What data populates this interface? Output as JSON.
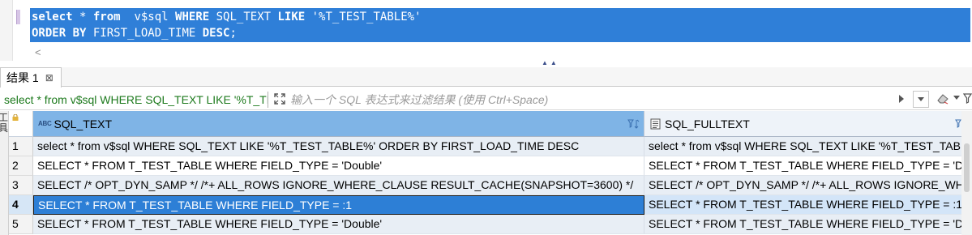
{
  "editor": {
    "line1": {
      "kw_select": "select",
      "star": " * ",
      "kw_from": "from",
      "table": "  v$sql ",
      "kw_where": "WHERE",
      "col": " SQL_TEXT ",
      "kw_like": "LIKE",
      "pattern": " '%T_TEST_TABLE%'"
    },
    "line2": {
      "kw_orderby": "ORDER BY",
      "rest": " FIRST_LOAD_TIME ",
      "kw_desc": "DESC",
      "semicolon": ";"
    },
    "hscroll_left": "<"
  },
  "splitter": {
    "arrows": "▲▲"
  },
  "tab": {
    "label": "结果 1",
    "close": "⊠"
  },
  "filter": {
    "current_query": "select * from v$sql WHERE SQL_TEXT LIKE '%T_TEST_TABLE%' ORDER BY FIRST_LOAD_TIME DESC",
    "placeholder": "输入一个 SQL 表达式来过滤结果 (使用 Ctrl+Space)"
  },
  "side_strip": {
    "text": "工具"
  },
  "grid": {
    "columns": [
      {
        "type_badge": "ABC",
        "label": "SQL_TEXT"
      },
      {
        "label": "SQL_FULLTEXT"
      }
    ],
    "rows": [
      {
        "num": "1",
        "sql_text": "select * from  v$sql WHERE SQL_TEXT LIKE '%T_TEST_TABLE%' ORDER BY FIRST_LOAD_TIME DESC",
        "sql_fulltext": "select * from  v$sql WHERE SQL_TEXT LIKE '%T_TEST_TABLE%' ORDER BY FIRST_LOAD_TIME DESC"
      },
      {
        "num": "2",
        "sql_text": "SELECT * FROM T_TEST_TABLE WHERE FIELD_TYPE = 'Double'",
        "sql_fulltext": "SELECT * FROM T_TEST_TABLE WHERE FIELD_TYPE = 'Double'"
      },
      {
        "num": "3",
        "sql_text": "SELECT /* OPT_DYN_SAMP */ /*+ ALL_ROWS IGNORE_WHERE_CLAUSE RESULT_CACHE(SNAPSHOT=3600) */",
        "sql_fulltext": "SELECT /* OPT_DYN_SAMP */ /*+ ALL_ROWS IGNORE_WHERE_CLAUSE RESULT_CACHE(SNAPSHOT=3600) */"
      },
      {
        "num": "4",
        "sql_text": "SELECT * FROM T_TEST_TABLE WHERE FIELD_TYPE = :1",
        "sql_fulltext": "SELECT * FROM T_TEST_TABLE WHERE FIELD_TYPE = :1"
      },
      {
        "num": "5",
        "sql_text": "SELECT * FROM T_TEST_TABLE WHERE FIELD_TYPE = 'Double'",
        "sql_fulltext": "SELECT * FROM T_TEST_TABLE WHERE FIELD_TYPE = 'Double'"
      }
    ],
    "selected_row": "4"
  },
  "colors": {
    "selection": "#2f7fd8",
    "header_active": "#7fb4e6",
    "row_stripe": "#e8eef5",
    "filter_query": "#1d7a1d"
  }
}
